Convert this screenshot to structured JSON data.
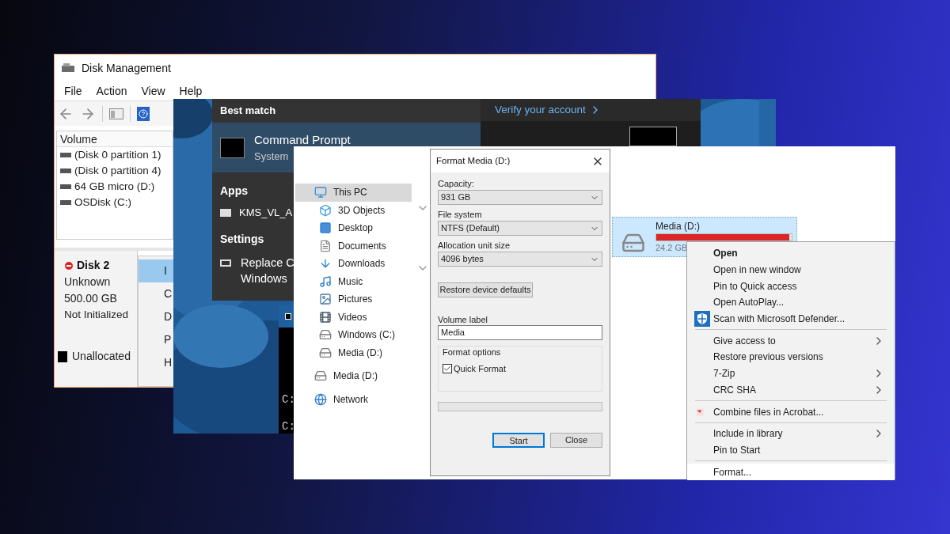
{
  "disk_management": {
    "title": "Disk Management",
    "menu": [
      "File",
      "Action",
      "View",
      "Help"
    ],
    "volume_header": "Volume",
    "volumes": [
      "(Disk 0 partition 1)",
      "(Disk 0 partition 4)",
      "64 GB micro (D:)",
      "OSDisk (C:)"
    ],
    "disk": {
      "name": "Disk 2",
      "type": "Unknown",
      "size": "500.00 GB",
      "status": "Not Initialized"
    },
    "context_menu": [
      {
        "label": "I",
        "selected": true
      },
      {
        "label": "C",
        "selected": false
      },
      {
        "label": "D",
        "selected": false
      },
      {
        "label": "P",
        "selected": false
      },
      {
        "label": "H",
        "selected": false
      }
    ],
    "legend": [
      {
        "label": "Unallocated",
        "color": "#000000"
      }
    ]
  },
  "search": {
    "best_match_heading": "Best match",
    "best_match": {
      "title": "Command Prompt",
      "subtitle": "System"
    },
    "apps_heading": "Apps",
    "apps": [
      "KMS_VL_A"
    ],
    "settings_heading": "Settings",
    "settings": [
      {
        "lines": [
          "Replace C",
          "Windows"
        ]
      }
    ],
    "verify_link": "Verify your account"
  },
  "command_prompt": {
    "lines": [
      "C:",
      "C:"
    ]
  },
  "explorer": {
    "nav": [
      {
        "label": "This PC",
        "kind": "pc",
        "selected": true,
        "children": [
          {
            "label": "3D Objects",
            "kind": "objects",
            "selected": false
          },
          {
            "label": "Desktop",
            "kind": "desktop",
            "selected": false
          },
          {
            "label": "Documents",
            "kind": "documents",
            "selected": false
          },
          {
            "label": "Downloads",
            "kind": "downloads",
            "selected": false
          },
          {
            "label": "Music",
            "kind": "music",
            "selected": false
          },
          {
            "label": "Pictures",
            "kind": "pictures",
            "selected": false
          },
          {
            "label": "Videos",
            "kind": "videos",
            "selected": false
          },
          {
            "label": "Windows (C:)",
            "kind": "drive",
            "selected": false
          },
          {
            "label": "Media (D:)",
            "kind": "drive",
            "selected": false
          }
        ]
      },
      {
        "label": "Media (D:)",
        "kind": "drive",
        "selected": false
      },
      {
        "label": "Network",
        "kind": "network",
        "selected": false
      }
    ],
    "drive": {
      "name": "Media (D:)",
      "size": "24.2 GB",
      "level": 0.98,
      "selected": true
    }
  },
  "format_dialog": {
    "title": "Format Media (D:)",
    "fields": [
      {
        "label": "Capacity:",
        "value": "931 GB"
      },
      {
        "label": "File system",
        "value": "NTFS (Default)"
      },
      {
        "label": "Allocation unit size",
        "value": "4096 bytes"
      }
    ],
    "restore_button": "Restore device defaults",
    "volume_label": {
      "label": "Volume label",
      "value": "Media"
    },
    "format_options": {
      "legend": "Format options",
      "quick_format": {
        "label": "Quick Format",
        "checked": true
      }
    },
    "progress": {
      "level": 0
    },
    "buttons": [
      {
        "label": "Start",
        "selected": true
      },
      {
        "label": "Close",
        "selected": false
      }
    ]
  },
  "context_menu": {
    "sections": [
      [
        {
          "label": "Open",
          "kind": "plain",
          "default": true,
          "submenu": false,
          "selected": false
        },
        {
          "label": "Open in new window",
          "kind": "plain",
          "default": false,
          "submenu": false,
          "selected": false
        },
        {
          "label": "Pin to Quick access",
          "kind": "plain",
          "default": false,
          "submenu": false,
          "selected": false
        },
        {
          "label": "Open AutoPlay...",
          "kind": "plain",
          "default": false,
          "submenu": false,
          "selected": false
        },
        {
          "label": "Scan with Microsoft Defender...",
          "kind": "shield",
          "default": false,
          "submenu": false,
          "selected": false
        }
      ],
      [
        {
          "label": "Give access to",
          "kind": "plain",
          "default": false,
          "submenu": true,
          "selected": false
        },
        {
          "label": "Restore previous versions",
          "kind": "plain",
          "default": false,
          "submenu": false,
          "selected": false
        },
        {
          "label": "7-Zip",
          "kind": "plain",
          "default": false,
          "submenu": true,
          "selected": false
        },
        {
          "label": "CRC SHA",
          "kind": "plain",
          "default": false,
          "submenu": true,
          "selected": false
        }
      ],
      [
        {
          "label": "Combine files in Acrobat...",
          "kind": "acrobat",
          "default": false,
          "submenu": false,
          "selected": false
        }
      ],
      [
        {
          "label": "Include in library",
          "kind": "plain",
          "default": false,
          "submenu": true,
          "selected": false
        },
        {
          "label": "Pin to Start",
          "kind": "plain",
          "default": false,
          "submenu": false,
          "selected": false
        }
      ],
      [
        {
          "label": "Format...",
          "kind": "plain",
          "default": false,
          "submenu": false,
          "selected": true
        }
      ]
    ]
  }
}
